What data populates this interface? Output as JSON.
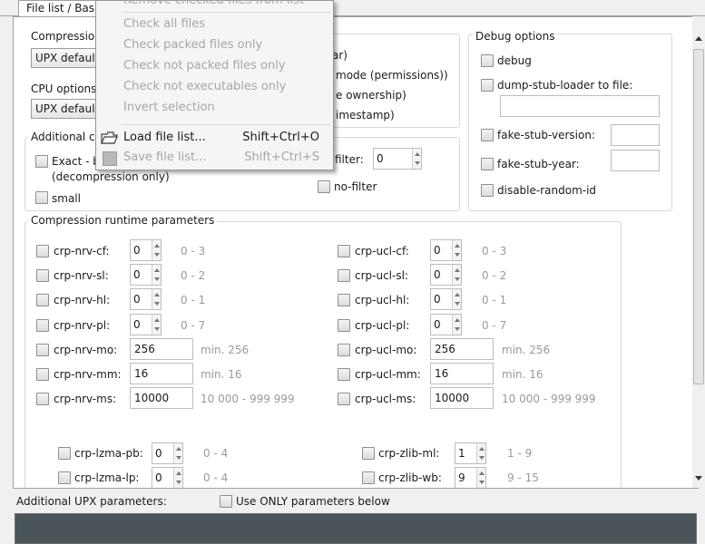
{
  "tabs": {
    "main": "File list / Basic"
  },
  "menu": {
    "items": [
      {
        "label": "Remove checked files from list",
        "shortcut": "",
        "disabled": true
      },
      {
        "label": "Check all files",
        "shortcut": "",
        "disabled": true
      },
      {
        "label": "Check packed files only",
        "shortcut": "",
        "disabled": true
      },
      {
        "label": "Check not packed files only",
        "shortcut": "",
        "disabled": true
      },
      {
        "label": "Check not executables only",
        "shortcut": "",
        "disabled": true
      },
      {
        "label": "Invert selection",
        "shortcut": "",
        "disabled": true
      },
      {
        "label": "Load file list...",
        "shortcut": "Shift+Ctrl+O",
        "disabled": false
      },
      {
        "label": "Save file list...",
        "shortcut": "Shift+Ctrl+S",
        "disabled": true
      }
    ]
  },
  "compression": {
    "label": "Compression",
    "value": "UPX default"
  },
  "cpu": {
    "label": "CPU options:",
    "value": "UPX default"
  },
  "overlay": {
    "opt1": "ar)",
    "opt2": "mode (permissions))",
    "opt3": "e ownership)",
    "opt4": "imestamp)"
  },
  "additional": {
    "title": "Additional co",
    "exact": "Exact - b",
    "exact_note": "(decompression only)",
    "small": "small",
    "filter_label": "filter:",
    "filter_value": "0",
    "nofilter": "no-filter"
  },
  "debug": {
    "title": "Debug options",
    "debug": "debug",
    "dump": "dump-stub-loader to file:",
    "fake_version": "fake-stub-version:",
    "fake_year": "fake-stub-year:",
    "disable_random": "disable-random-id"
  },
  "runtime": {
    "title": "Compression runtime parameters",
    "left": [
      {
        "name": "crp-nrv-cf:",
        "value": "0",
        "range": "0 - 3",
        "spin": true
      },
      {
        "name": "crp-nrv-sl:",
        "value": "0",
        "range": "0 - 2",
        "spin": true
      },
      {
        "name": "crp-nrv-hl:",
        "value": "0",
        "range": "0 - 1",
        "spin": true
      },
      {
        "name": "crp-nrv-pl:",
        "value": "0",
        "range": "0 - 7",
        "spin": true
      },
      {
        "name": "crp-nrv-mo:",
        "value": "256",
        "range": "min. 256",
        "spin": false
      },
      {
        "name": "crp-nrv-mm:",
        "value": "16",
        "range": "min. 16",
        "spin": false
      },
      {
        "name": "crp-nrv-ms:",
        "value": "10000",
        "range": "10 000 - 999 999",
        "spin": false
      }
    ],
    "right": [
      {
        "name": "crp-ucl-cf:",
        "value": "0",
        "range": "0 - 3",
        "spin": true
      },
      {
        "name": "crp-ucl-sl:",
        "value": "0",
        "range": "0 - 2",
        "spin": true
      },
      {
        "name": "crp-ucl-hl:",
        "value": "0",
        "range": "0 - 1",
        "spin": true
      },
      {
        "name": "crp-ucl-pl:",
        "value": "0",
        "range": "0 - 7",
        "spin": true
      },
      {
        "name": "crp-ucl-mo:",
        "value": "256",
        "range": "min. 256",
        "spin": false
      },
      {
        "name": "crp-ucl-mm:",
        "value": "16",
        "range": "min. 16",
        "spin": false
      },
      {
        "name": "crp-ucl-ms:",
        "value": "10000",
        "range": "10 000 - 999 999",
        "spin": false
      }
    ],
    "lzma": [
      {
        "name": "crp-lzma-pb:",
        "value": "0",
        "range": "0 - 4"
      },
      {
        "name": "crp-lzma-lp:",
        "value": "0",
        "range": "0 - 4"
      }
    ],
    "zlib": [
      {
        "name": "crp-zlib-ml:",
        "value": "1",
        "range": "1 - 9"
      },
      {
        "name": "crp-zlib-wb:",
        "value": "9",
        "range": "9 - 15"
      }
    ]
  },
  "bottom": {
    "additional_label": "Additional UPX parameters:",
    "only_label": "Use ONLY parameters below"
  }
}
